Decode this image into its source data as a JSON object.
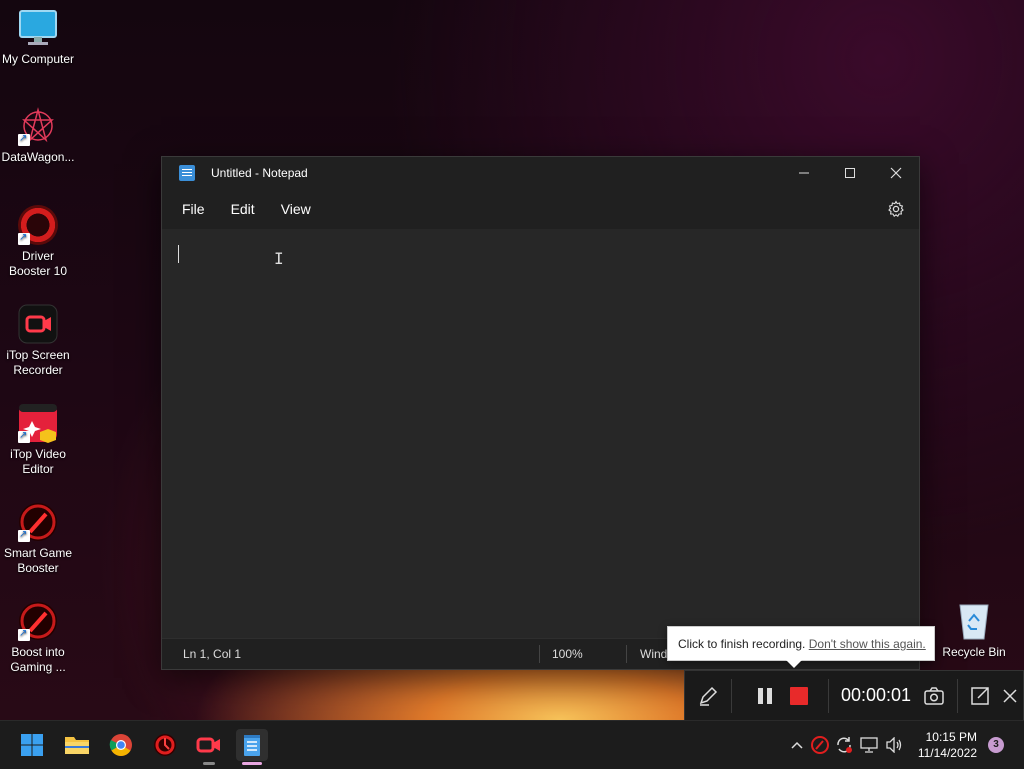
{
  "desktop": {
    "icons": [
      {
        "label": "My Computer",
        "icon": "monitor-icon"
      },
      {
        "label": "DataWagon...",
        "icon": "datawagon-icon"
      },
      {
        "label": "Driver Booster 10",
        "icon": "driver-booster-icon"
      },
      {
        "label": "iTop Screen Recorder",
        "icon": "itop-screen-recorder-icon"
      },
      {
        "label": "iTop Video Editor",
        "icon": "itop-video-editor-icon"
      },
      {
        "label": "Smart Game Booster",
        "icon": "smart-game-booster-icon"
      },
      {
        "label": "Boost into Gaming ...",
        "icon": "boost-gaming-icon"
      },
      {
        "label": "Recycle Bin",
        "icon": "recycle-bin-icon"
      }
    ]
  },
  "notepad": {
    "title": "Untitled - Notepad",
    "menu": [
      "File",
      "Edit",
      "View"
    ],
    "status": {
      "position": "Ln 1, Col 1",
      "zoom": "100%",
      "line_ending": "Wind"
    },
    "content": ""
  },
  "recorder": {
    "tooltip_text": "Click to finish recording.",
    "tooltip_link": "Don't show this again.",
    "timer": "00:00:01",
    "accent": "#e82a2a"
  },
  "taskbar": {
    "time": "10:15 PM",
    "date": "11/14/2022",
    "notifications": "3"
  }
}
